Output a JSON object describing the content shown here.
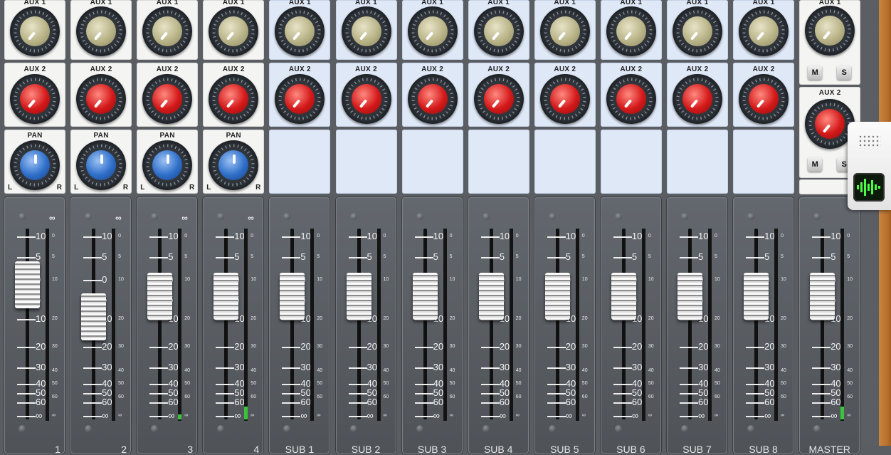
{
  "labels": {
    "aux1": "AUX 1",
    "aux2": "AUX 2",
    "pan": "PAN",
    "left": "L",
    "right": "R",
    "mute": "M",
    "solo": "S"
  },
  "scale_left": [
    "10",
    "5",
    "0",
    "5",
    "10",
    "20",
    "30",
    "40",
    "50",
    "60",
    "∞"
  ],
  "scale_right": [
    "0",
    "5",
    "10",
    "20",
    "30",
    "40",
    "50",
    "60",
    "∞"
  ],
  "link_symbol": "∞",
  "channels": [
    {
      "name": "1",
      "type": "input",
      "fader_level": 0.74
    },
    {
      "name": "2",
      "type": "input",
      "fader_level": 0.57
    },
    {
      "name": "3",
      "type": "input",
      "fader_level": 0.68
    },
    {
      "name": "4",
      "type": "input",
      "fader_level": 0.68
    },
    {
      "name": "SUB 1",
      "type": "sub",
      "fader_level": 0.68
    },
    {
      "name": "SUB 2",
      "type": "sub",
      "fader_level": 0.68
    },
    {
      "name": "SUB 3",
      "type": "sub",
      "fader_level": 0.68
    },
    {
      "name": "SUB 4",
      "type": "sub",
      "fader_level": 0.68
    },
    {
      "name": "SUB 5",
      "type": "sub",
      "fader_level": 0.68
    },
    {
      "name": "SUB 6",
      "type": "sub",
      "fader_level": 0.68
    },
    {
      "name": "SUB 7",
      "type": "sub",
      "fader_level": 0.68
    },
    {
      "name": "SUB 8",
      "type": "sub",
      "fader_level": 0.68
    },
    {
      "name": "MASTER",
      "type": "master",
      "fader_level": 0.68
    }
  ],
  "colors": {
    "aux1_knob": "#b9b488",
    "aux2_knob": "#d4191a",
    "pan_knob": "#2f6fc9",
    "meter_led": "#39c43b"
  },
  "side_panel": {
    "icons": [
      "grid-dots-icon",
      "waveform-icon"
    ]
  }
}
